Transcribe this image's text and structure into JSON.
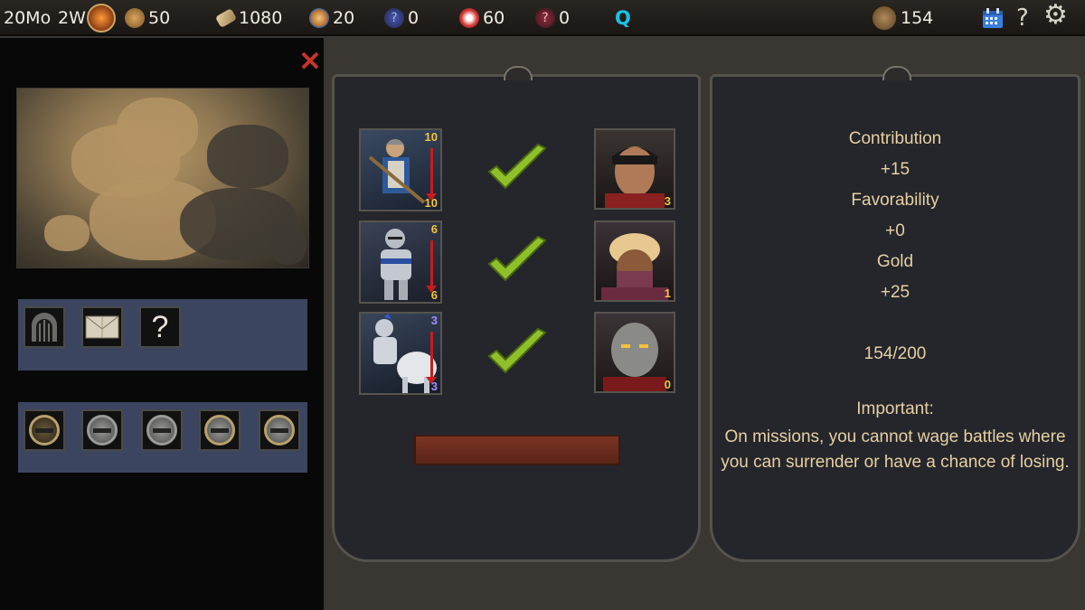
{
  "topbar": {
    "date_month": "20Mo",
    "date_week": "2W",
    "food": "50",
    "lumber": "1080",
    "population": "20",
    "unknown_a": "0",
    "army": "60",
    "unknown_b": "0",
    "quest_glyph": "Q",
    "coins": "154",
    "help_glyph": "?",
    "settings_glyph": "⚙"
  },
  "left": {
    "close_glyph": "✕",
    "slot_help_glyph": "?"
  },
  "mission": {
    "units": [
      {
        "top": "10",
        "bottom": "10",
        "top_color": "#f4c33b"
      },
      {
        "top": "6",
        "bottom": "6",
        "top_color": "#f4c33b"
      },
      {
        "top": "3",
        "bottom": "3",
        "top_color": "#a78bff"
      }
    ],
    "heroes": [
      {
        "level": "3"
      },
      {
        "level": "1"
      },
      {
        "level": "0"
      }
    ]
  },
  "rewards": {
    "contribution_label": "Contribution",
    "contribution_value": "+15",
    "favorability_label": "Favorability",
    "favorability_value": "+0",
    "gold_label": "Gold",
    "gold_value": "+25",
    "progress": "154/200",
    "important_label": "Important:",
    "important_text": "On missions, you cannot wage battles where you can surrender or have a chance of losing."
  },
  "colors": {
    "accent_red": "#c81c1c",
    "check_green": "#8fc02a",
    "reward_text": "#e8cfa2",
    "quest_cyan": "#19c2e6"
  }
}
